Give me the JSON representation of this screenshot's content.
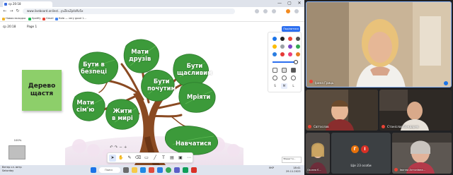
{
  "browser": {
    "tab_title": "ср 20:18",
    "address": "www.liveboard.online/...yvZkvZpllzRz5x",
    "bookmarks": [
      "Новая вкладка",
      "Spotify",
      "Gmail",
      "Київ — very good 1..."
    ],
    "window_controls": [
      "—",
      "▢",
      "✕"
    ]
  },
  "whiteboard": {
    "board_name": "ср 20:18",
    "page_label": "Page 1",
    "share_button": "Поділитися",
    "zoom_label": "100%",
    "sticky_text": [
      "Дерево",
      "щастя"
    ],
    "leaves": [
      {
        "id": "buty-v-bezpetsi",
        "lines": [
          "Бути в",
          "безпеці"
        ]
      },
      {
        "id": "maty-druziv",
        "lines": [
          "Мати",
          "друзів"
        ]
      },
      {
        "id": "buty-shchaslyvym",
        "lines": [
          "Бути",
          "щасливим"
        ]
      },
      {
        "id": "buty-pochutym",
        "lines": [
          "Бути",
          "почутим"
        ]
      },
      {
        "id": "mriiaty",
        "lines": [
          "Мріяти"
        ]
      },
      {
        "id": "maty-simiu",
        "lines": [
          "Мати",
          "сім'ю"
        ]
      },
      {
        "id": "zhyty-v-myri",
        "lines": [
          "Жити",
          "в мирі"
        ]
      },
      {
        "id": "navchatysia",
        "lines": [
          "Навчатися"
        ]
      }
    ],
    "palette": [
      "#1a73e8",
      "#222222",
      "#ea4335",
      "#4f4f4f",
      "#fbbc04",
      "#9aa0a6",
      "#7b46c7",
      "#34a853",
      "#2a7de1",
      "#e53935",
      "#ec407a",
      "#e67c22"
    ],
    "sizes": [
      "S",
      "M",
      "L"
    ],
    "corner_note": "Зберегти..."
  },
  "taskbar": {
    "weather_line1": "Ветер сл. ветр",
    "weather_line2": "Saturday",
    "search_label": "Поиск",
    "language": "УКР",
    "time": "18:41",
    "date": "29.11.2023"
  },
  "meeting": {
    "main_speaker": "Ірина Гриць",
    "tiles": [
      {
        "name": "Світослав"
      },
      {
        "name": "Станіслав Бондарев"
      },
      {
        "name": "Оксана Є..."
      },
      {
        "name": "Ще 23 особи"
      },
      {
        "name": "Іванна Антонівна..."
      }
    ],
    "others_avatars": [
      "Г",
      "І"
    ]
  },
  "colors": {
    "leaf_green": "#3c9a3a",
    "accent_blue": "#2c6ff0",
    "sticky_green": "#8dcf6a"
  }
}
